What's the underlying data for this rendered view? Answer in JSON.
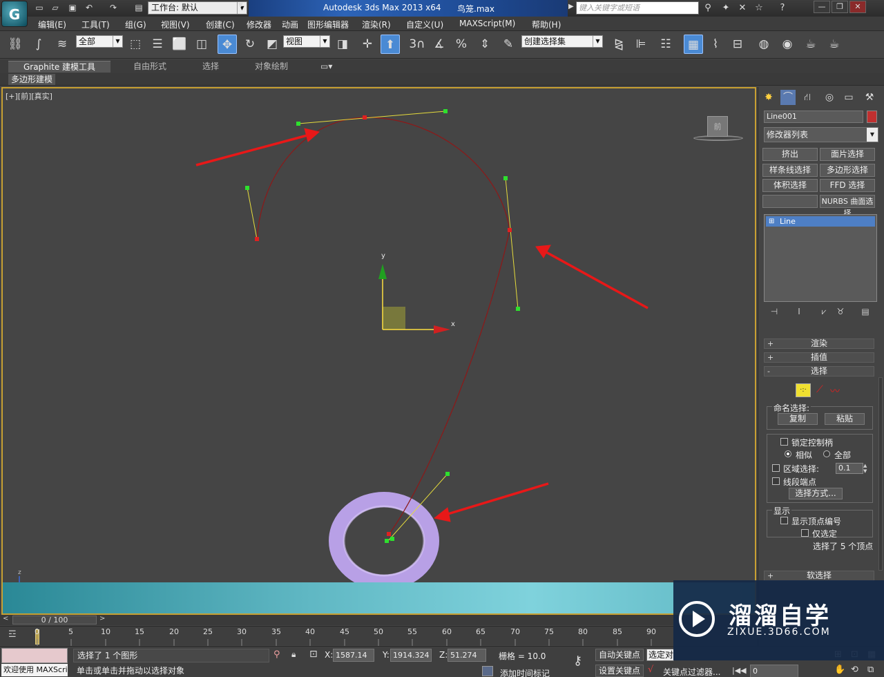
{
  "titlebar": {
    "workspace_label": "工作台: 默认",
    "app_title": "Autodesk 3ds Max  2013 x64",
    "file_name": "鸟笼.max",
    "search_placeholder": "键入关键字或短语"
  },
  "menu": [
    "编辑(E)",
    "工具(T)",
    "组(G)",
    "视图(V)",
    "创建(C)",
    "修改器",
    "动画",
    "图形编辑器",
    "渲染(R)",
    "自定义(U)",
    "MAXScript(M)",
    "帮助(H)"
  ],
  "toolbar": {
    "selection_filter": "全部",
    "ref_coord": "视图",
    "named_selection": "创建选择集"
  },
  "ribbon": {
    "tabs": [
      "Graphite 建模工具",
      "自由形式",
      "选择",
      "对象绘制"
    ],
    "sub_label": "多边形建模"
  },
  "viewport": {
    "label": "[+][前][真实]",
    "viewcube_label": "前",
    "axis_x": "x",
    "axis_y": "y",
    "axis_z": "z"
  },
  "command_panel": {
    "object_name": "Line001",
    "object_color": "#c03030",
    "modifier_list": "修改器列表",
    "modifier_buttons": [
      "挤出",
      "面片选择",
      "样条线选择",
      "多边形选择",
      "体积选择",
      "FFD 选择",
      "",
      "NURBS 曲面选择"
    ],
    "stack_item": "Line",
    "rollouts": {
      "render": "渲染",
      "interp": "插值",
      "selection": "选择",
      "soft": "软选择"
    },
    "named_selection_label": "命名选择:",
    "copy_label": "复制",
    "paste_label": "粘贴",
    "lock_handles": "锁定控制柄",
    "similar": "相似",
    "all": "全部",
    "area_select": "区域选择:",
    "area_value": "0.1",
    "segment_end": "线段端点",
    "select_by": "选择方式...",
    "display_label": "显示",
    "show_vertex_numbers": "显示顶点编号",
    "selected_only": "仅选定",
    "selection_status": "选择了 5 个顶点"
  },
  "timeline": {
    "frame_counter": "0 / 100",
    "ticks": [
      "0",
      "5",
      "10",
      "15",
      "20",
      "25",
      "30",
      "35",
      "40",
      "45",
      "50",
      "55",
      "60",
      "65",
      "70",
      "75",
      "80",
      "85",
      "90"
    ]
  },
  "status": {
    "welcome": "欢迎使用 MAXScript",
    "message": "选择了 1 个图形",
    "prompt": "单击或单击并拖动以选择对象",
    "x_label": "X:",
    "x_value": "1587.14",
    "y_label": "Y:",
    "y_value": "1914.324",
    "z_label": "Z:",
    "z_value": "51.274",
    "grid": "栅格 = 10.0",
    "auto_key": "自动关键点",
    "set_key": "设置关键点",
    "selected_dropdown": "选定对",
    "key_filter": "关键点过滤器...",
    "add_time_tag": "添加时间标记",
    "frame_field": "0"
  },
  "watermark": {
    "title": "溜溜自学",
    "url": "ZIXUE.3D66.COM"
  }
}
